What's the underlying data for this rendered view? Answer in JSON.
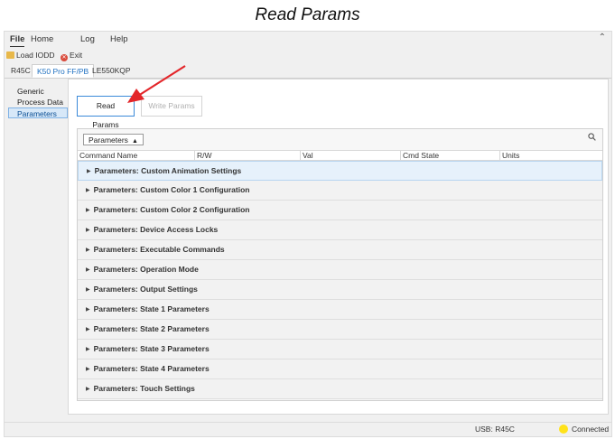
{
  "caption": "Read Params",
  "menu": {
    "items": [
      "File",
      "Home",
      "Log",
      "Help"
    ],
    "active": "File"
  },
  "ribbon": {
    "load_label": "Load IODD",
    "exit_label": "Exit"
  },
  "device_tabs": [
    "R45C",
    "K50 Pro FF/PB",
    "LE550KQP"
  ],
  "active_device_tab": "K50 Pro FF/PB",
  "sidebar": {
    "items": [
      "Generic",
      "Process Data",
      "Parameters"
    ],
    "active": "Parameters"
  },
  "toolbar": {
    "read_label": "Read Params",
    "write_label": "Write Params"
  },
  "grid": {
    "group_chip": "Parameters",
    "columns": [
      "Command Name",
      "R/W",
      "Val",
      "Cmd State",
      "Units"
    ],
    "rows": [
      "Parameters: Custom Animation Settings",
      "Parameters: Custom Color 1 Configuration",
      "Parameters: Custom Color 2 Configuration",
      "Parameters: Device Access Locks",
      "Parameters: Executable Commands",
      "Parameters: Operation Mode",
      "Parameters: Output Settings",
      "Parameters: State 1 Parameters",
      "Parameters: State 2 Parameters",
      "Parameters: State 3 Parameters",
      "Parameters: State 4 Parameters",
      "Parameters: Touch Settings"
    ]
  },
  "status": {
    "usb_label": "USB: R45C",
    "connection": "Connected",
    "connection_color": "#ffe21a"
  },
  "colors": {
    "accent": "#1d6fc0",
    "callout_arrow": "#e3262a"
  }
}
